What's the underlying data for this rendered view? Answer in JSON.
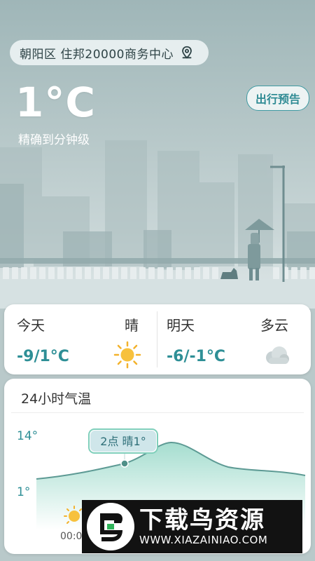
{
  "header": {
    "location": "朝阳区  住邦20000商务中心",
    "location_icon": "location-pin-icon",
    "temperature": "1°C",
    "precision": "精确到分钟级",
    "travel_button": "出行预告"
  },
  "forecast": {
    "today": {
      "name": "今天",
      "condition": "晴",
      "range": "-9/1°C",
      "icon": "sun-icon"
    },
    "tomorrow": {
      "name": "明天",
      "condition": "多云",
      "range": "-6/-1°C",
      "icon": "cloud-icon"
    }
  },
  "hourly": {
    "title": "24小时气温",
    "y_max_label": "14°",
    "y_min_label": "1°",
    "tooltip": "2点  晴1°",
    "first_time": "00:0"
  },
  "colors": {
    "accent": "#2e8f96",
    "curve": "#7fcfbb"
  },
  "watermark": {
    "brand": "下载鸟资源",
    "url": "WWW.XIAZAINIAO.COM"
  }
}
